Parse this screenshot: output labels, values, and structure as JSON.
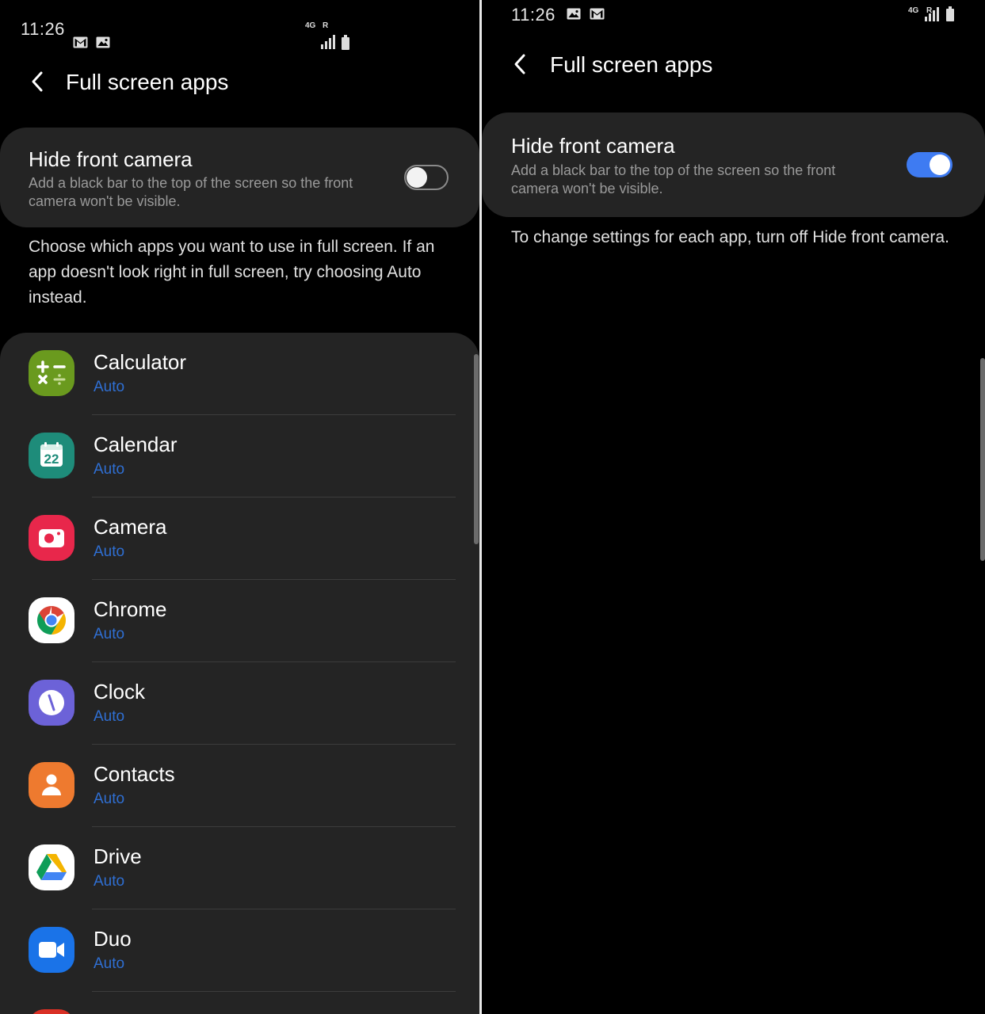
{
  "left": {
    "status": {
      "time": "11:26",
      "icons": [
        "gmail-icon",
        "image-icon"
      ],
      "network": "4G",
      "roaming": "R"
    },
    "header": {
      "back_icon": "chevron-left-icon",
      "title": "Full screen apps"
    },
    "hide_camera": {
      "title": "Hide front camera",
      "description": "Add a black bar to the top of the screen so the front camera won't be visible.",
      "enabled": false
    },
    "info": "Choose which apps you want to use in full screen. If an app doesn't look right in full screen, try choosing Auto instead.",
    "apps": [
      {
        "name": "Calculator",
        "mode": "Auto",
        "icon": "calculator-icon",
        "color": "#6a9a1e"
      },
      {
        "name": "Calendar",
        "mode": "Auto",
        "icon": "calendar-icon",
        "color": "#1e8c7a",
        "day": "22"
      },
      {
        "name": "Camera",
        "mode": "Auto",
        "icon": "camera-icon",
        "color": "#e8274b"
      },
      {
        "name": "Chrome",
        "mode": "Auto",
        "icon": "chrome-icon",
        "color": "#ffffff"
      },
      {
        "name": "Clock",
        "mode": "Auto",
        "icon": "clock-icon",
        "color": "#6c62d8"
      },
      {
        "name": "Contacts",
        "mode": "Auto",
        "icon": "contacts-icon",
        "color": "#ee7a2f"
      },
      {
        "name": "Drive",
        "mode": "Auto",
        "icon": "drive-icon",
        "color": "#ffffff"
      },
      {
        "name": "Duo",
        "mode": "Auto",
        "icon": "duo-icon",
        "color": "#1a73e8"
      }
    ]
  },
  "right": {
    "status": {
      "time": "11:26",
      "icons": [
        "image-icon",
        "gmail-icon"
      ],
      "network": "4G",
      "roaming": "R"
    },
    "header": {
      "back_icon": "chevron-left-icon",
      "title": "Full screen apps"
    },
    "hide_camera": {
      "title": "Hide front camera",
      "description": "Add a black bar to the top of the screen so the front camera won't be visible.",
      "enabled": true
    },
    "info": "To change settings for each app, turn off Hide front camera."
  },
  "colors": {
    "accent": "#3e7bf2",
    "mode_text": "#2f6fd3",
    "card_bg": "#242424"
  }
}
